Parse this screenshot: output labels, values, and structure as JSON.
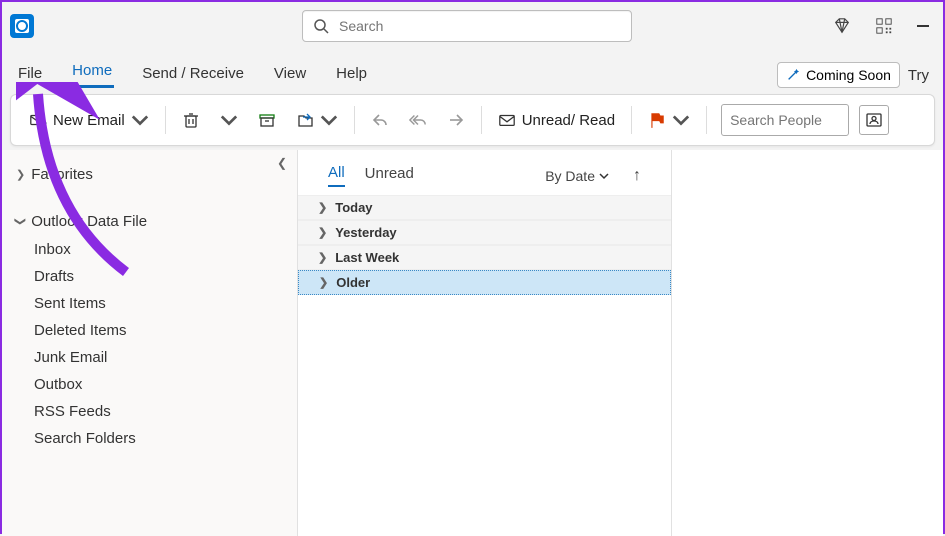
{
  "titlebar": {
    "search_placeholder": "Search"
  },
  "ribbon": {
    "tabs": [
      "File",
      "Home",
      "Send / Receive",
      "View",
      "Help"
    ],
    "active_index": 1,
    "coming_soon": "Coming Soon",
    "try": "Try"
  },
  "toolbar": {
    "new_email": "New Email",
    "unread_read": "Unread/ Read",
    "search_people_placeholder": "Search People"
  },
  "nav": {
    "favorites": "Favorites",
    "data_file": "Outlook Data File",
    "folders": [
      "Inbox",
      "Drafts",
      "Sent Items",
      "Deleted Items",
      "Junk Email",
      "Outbox",
      "RSS Feeds",
      "Search Folders"
    ]
  },
  "list": {
    "tabs": {
      "all": "All",
      "unread": "Unread"
    },
    "sort": "By Date",
    "groups": [
      "Today",
      "Yesterday",
      "Last Week",
      "Older"
    ],
    "selected_index": 3
  }
}
